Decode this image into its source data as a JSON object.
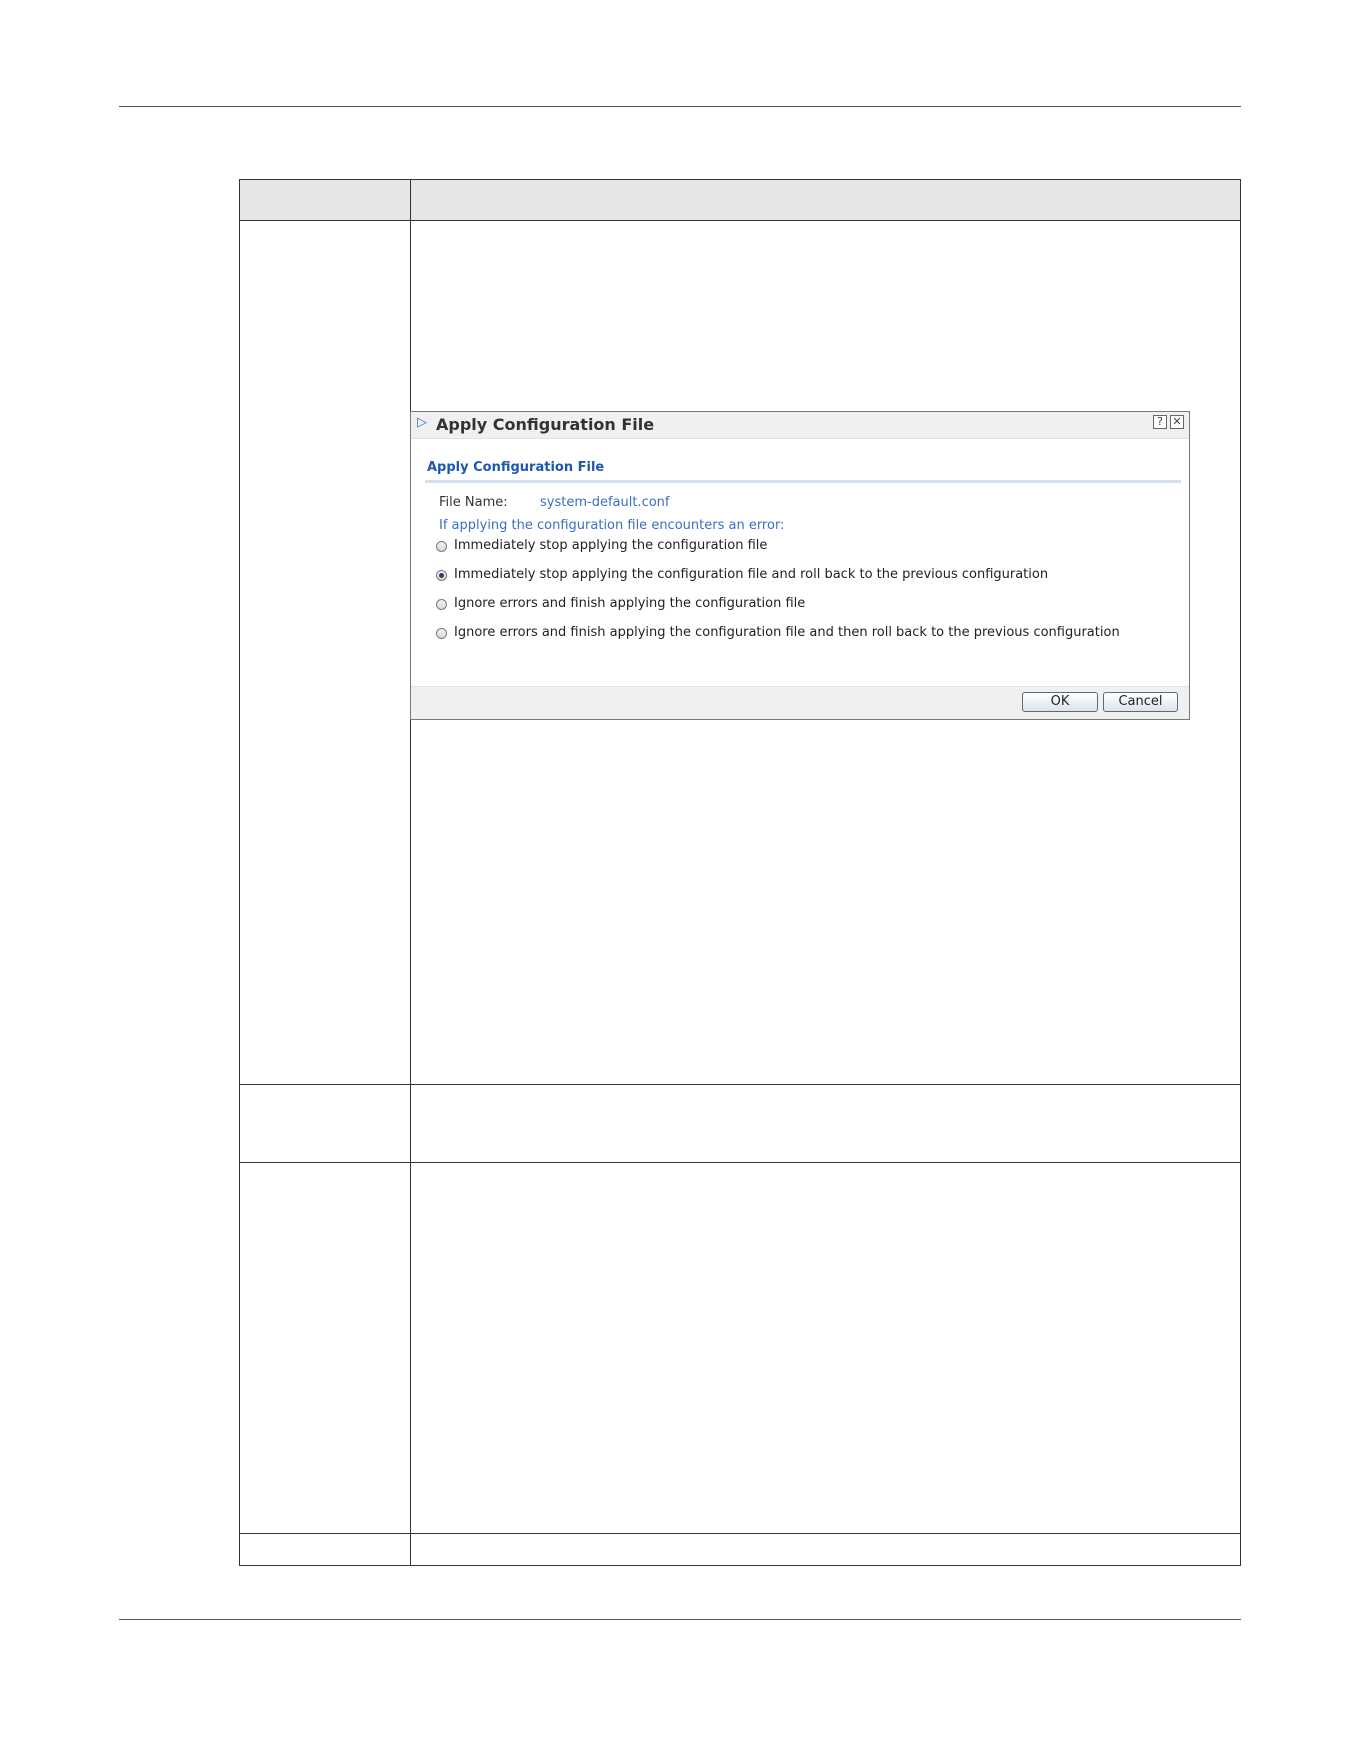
{
  "dialog": {
    "title": "Apply Configuration File",
    "help_glyph": "?",
    "close_glyph": "✕",
    "arrow_icon": "▷",
    "section_title": "Apply Configuration File",
    "file_name_label": "File Name:",
    "file_name_value": "system-default.conf",
    "error_prompt": "If applying the configuration file encounters an error:",
    "options": [
      {
        "label": "Immediately stop applying the configuration file",
        "checked": false
      },
      {
        "label": "Immediately stop applying the configuration file and roll back to the previous configuration",
        "checked": true
      },
      {
        "label": "Ignore errors and finish applying the configuration file",
        "checked": false
      },
      {
        "label": "Ignore errors and finish applying the configuration file and then roll back to the previous configuration",
        "checked": false
      }
    ],
    "ok_label": "OK",
    "cancel_label": "Cancel"
  },
  "colors": {
    "accent_blue": "#1f56b3",
    "link_blue": "#3a6fc4",
    "header_gray": "#e6e6e6"
  }
}
